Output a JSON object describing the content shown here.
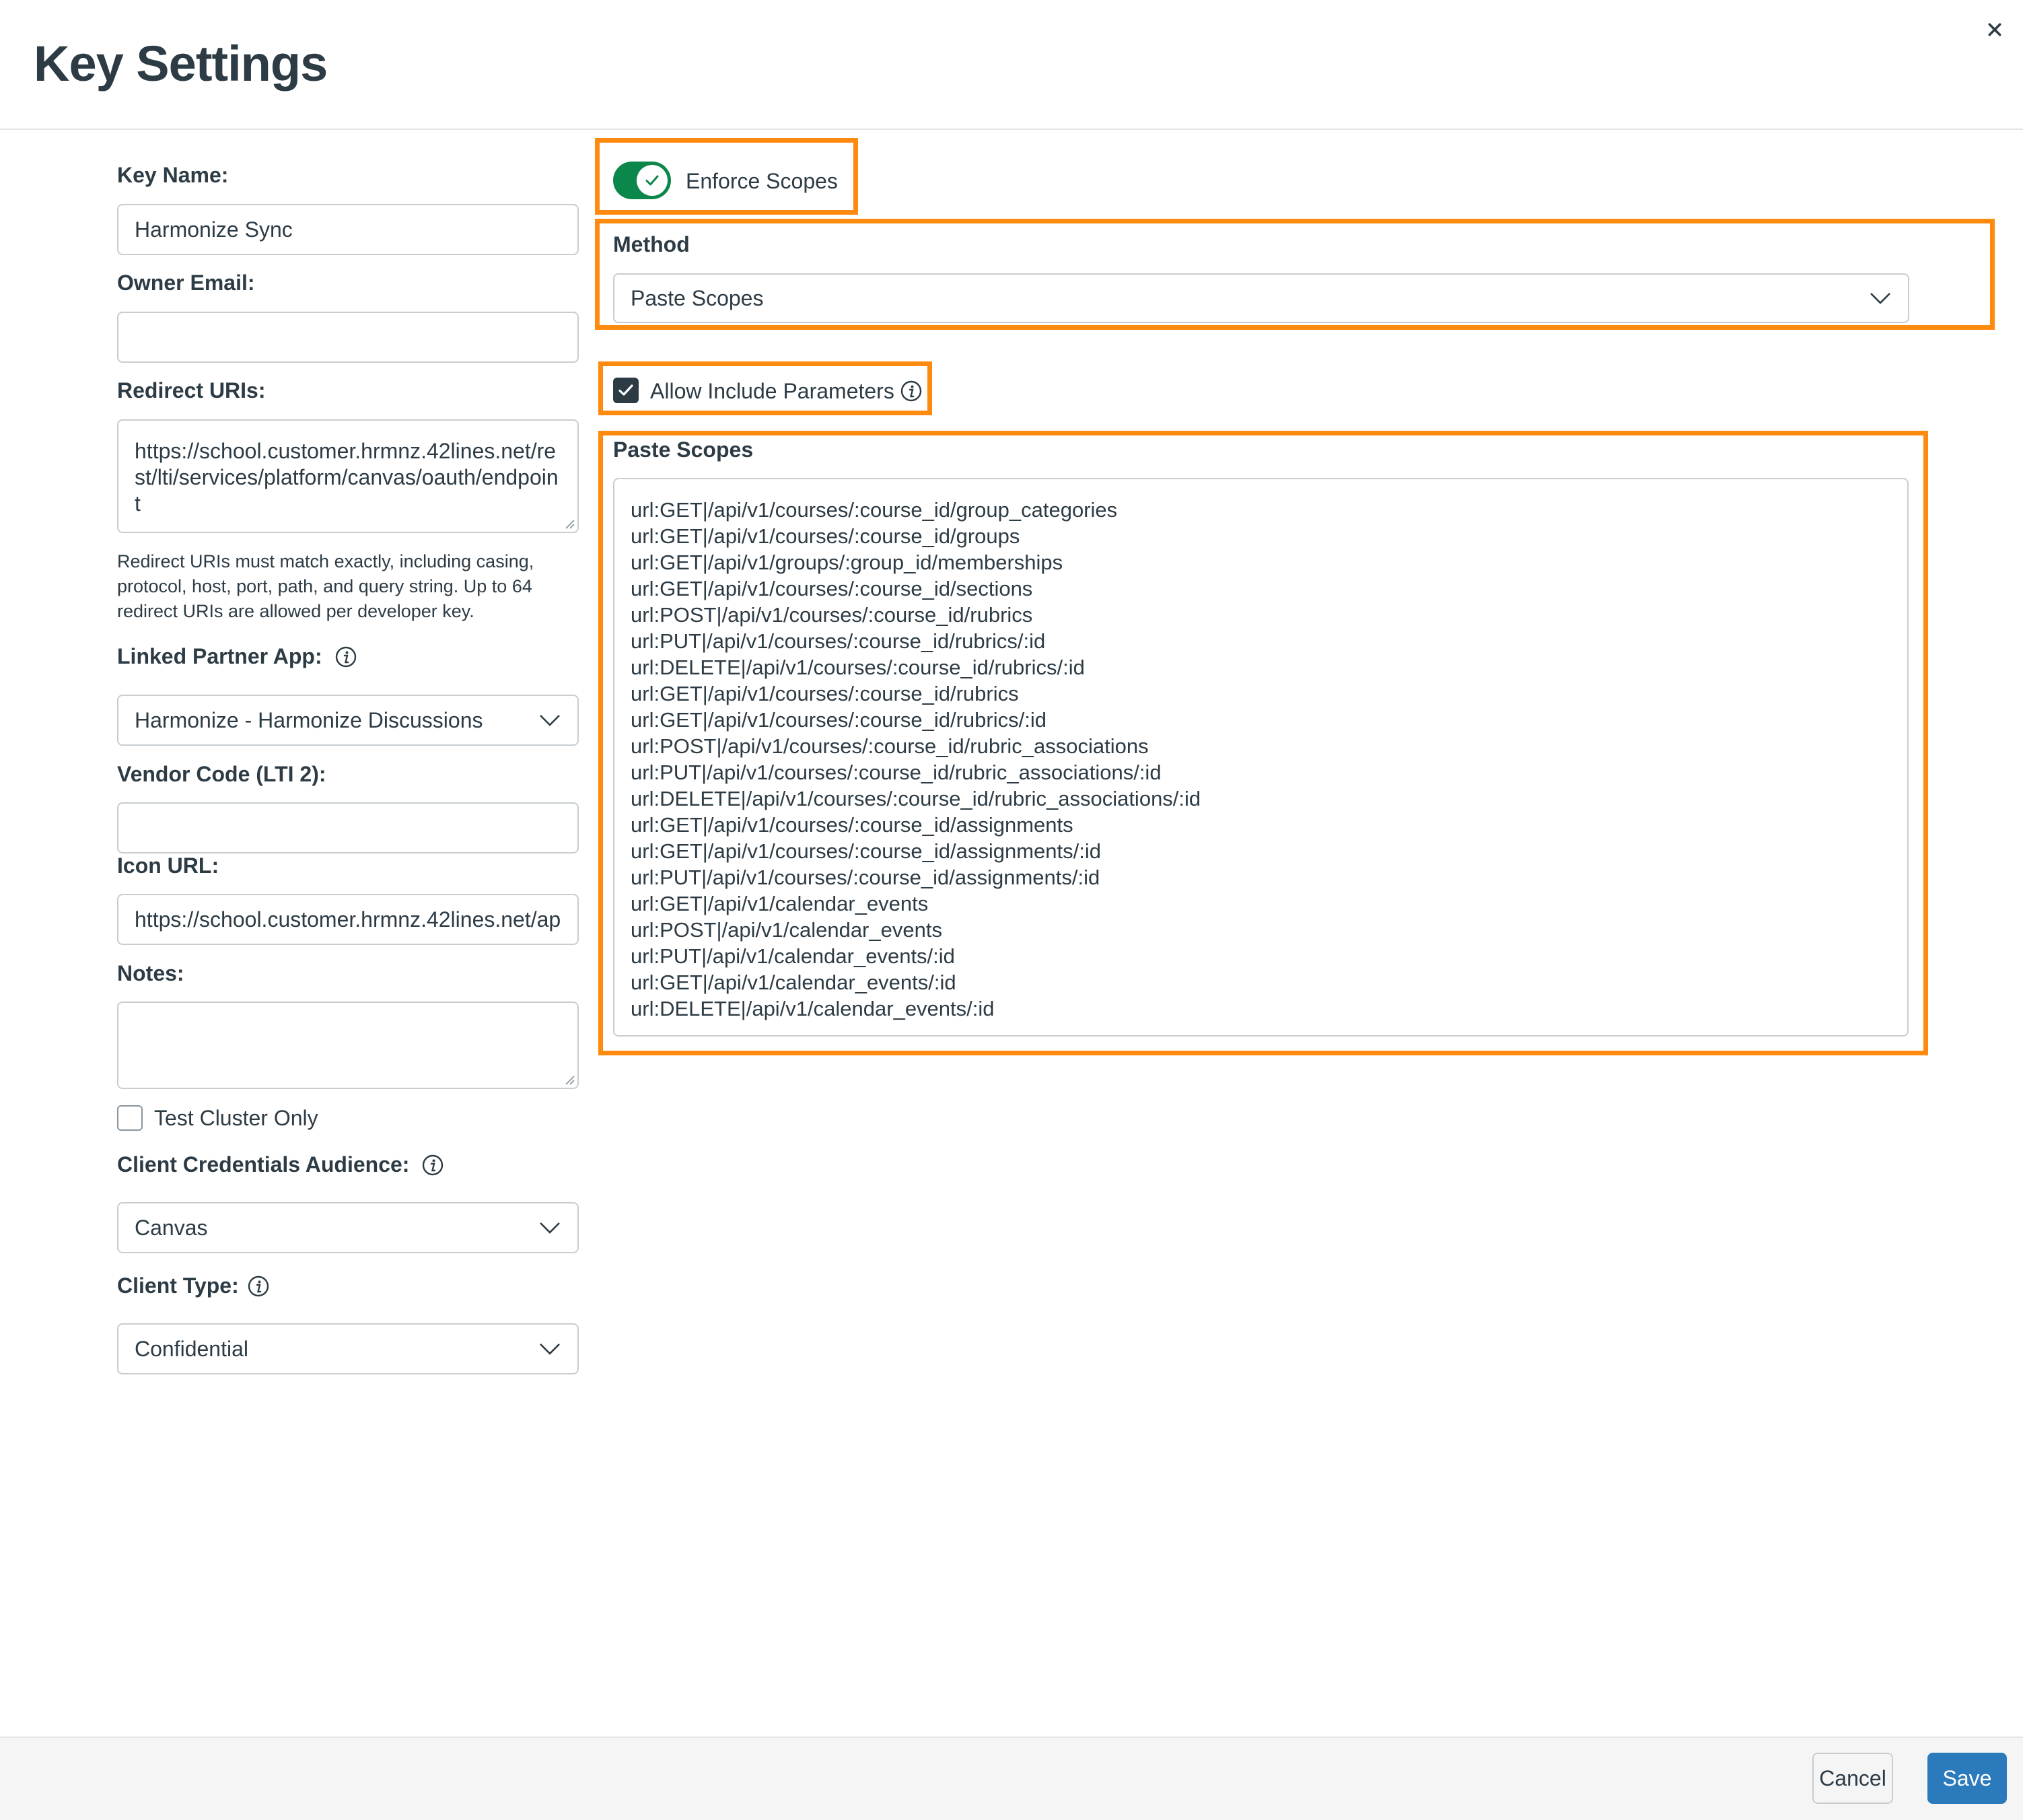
{
  "dialog": {
    "title": "Key Settings"
  },
  "form": {
    "key_name": {
      "label": "Key Name:",
      "value": "Harmonize Sync"
    },
    "owner_email": {
      "label": "Owner Email:",
      "value": ""
    },
    "redirect_uris": {
      "label": "Redirect URIs:",
      "value": "https://school.customer.hrmnz.42lines.net/rest/lti/services/platform/canvas/oauth/endpoint",
      "help": "Redirect URIs must match exactly, including casing, protocol, host, port, path, and query string. Up to 64 redirect URIs are allowed per developer key."
    },
    "linked_partner_app": {
      "label": "Linked Partner App:",
      "value": "Harmonize - Harmonize Discussions"
    },
    "vendor_code": {
      "label": "Vendor Code (LTI 2):",
      "value": ""
    },
    "icon_url": {
      "label": "Icon URL:",
      "value": "https://school.customer.hrmnz.42lines.net/ap"
    },
    "notes": {
      "label": "Notes:",
      "value": ""
    },
    "test_cluster_only": {
      "label": "Test Cluster Only",
      "checked": false
    },
    "client_credentials_audience": {
      "label": "Client Credentials Audience:",
      "value": "Canvas"
    },
    "client_type": {
      "label": "Client Type:",
      "value": "Confidential"
    }
  },
  "scopes": {
    "enforce_scopes": {
      "label": "Enforce Scopes",
      "on": true
    },
    "method": {
      "label": "Method",
      "value": "Paste Scopes"
    },
    "allow_include_parameters": {
      "label": "Allow Include Parameters",
      "checked": true
    },
    "paste_scopes": {
      "label": "Paste Scopes",
      "lines": [
        "url:GET|/api/v1/courses/:course_id/group_categories",
        "url:GET|/api/v1/courses/:course_id/groups",
        "url:GET|/api/v1/groups/:group_id/memberships",
        "url:GET|/api/v1/courses/:course_id/sections",
        "url:POST|/api/v1/courses/:course_id/rubrics",
        "url:PUT|/api/v1/courses/:course_id/rubrics/:id",
        "url:DELETE|/api/v1/courses/:course_id/rubrics/:id",
        "url:GET|/api/v1/courses/:course_id/rubrics",
        "url:GET|/api/v1/courses/:course_id/rubrics/:id",
        "url:POST|/api/v1/courses/:course_id/rubric_associations",
        "url:PUT|/api/v1/courses/:course_id/rubric_associations/:id",
        "url:DELETE|/api/v1/courses/:course_id/rubric_associations/:id",
        "url:GET|/api/v1/courses/:course_id/assignments",
        "url:GET|/api/v1/courses/:course_id/assignments/:id",
        "url:PUT|/api/v1/courses/:course_id/assignments/:id",
        "url:GET|/api/v1/calendar_events",
        "url:POST|/api/v1/calendar_events",
        "url:PUT|/api/v1/calendar_events/:id",
        "url:GET|/api/v1/calendar_events/:id",
        "url:DELETE|/api/v1/calendar_events/:id"
      ]
    }
  },
  "footer": {
    "cancel_label": "Cancel",
    "save_label": "Save"
  },
  "colors": {
    "highlight": "#ff8a10",
    "toggle_on": "#0b874b",
    "primary": "#2b7abc",
    "text": "#2d3b45"
  },
  "icons": {
    "close": "close-icon",
    "info": "info-icon",
    "chevron": "chevron-down-icon",
    "check": "checkmark-icon"
  }
}
